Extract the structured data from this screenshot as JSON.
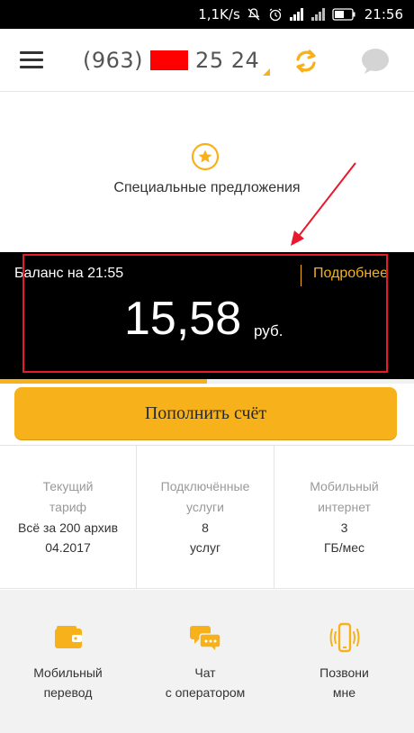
{
  "status_bar": {
    "speed": "1,1K/s",
    "time": "21:56",
    "icons": [
      "mute-icon",
      "alarm-icon",
      "signal-icon",
      "wifi-icon",
      "battery-icon"
    ]
  },
  "header": {
    "phone_prefix": "(963)",
    "phone_suffix": "25 24",
    "icons": [
      "menu-icon",
      "refresh-icon",
      "chat-icon"
    ]
  },
  "offers": {
    "label": "Специальные предложения",
    "icon": "star-icon"
  },
  "balance": {
    "label": "Баланс на 21:55",
    "more_label": "Подробнее",
    "amount": "15,58",
    "currency": "руб.",
    "progress": 0.5
  },
  "topup": {
    "label": "Пополнить счёт"
  },
  "info": [
    {
      "title_1": "Текущий",
      "title_2": "тариф",
      "value_1": "Всё за 200 архив",
      "value_2": "04.2017"
    },
    {
      "title_1": "Подключённые",
      "title_2": "услуги",
      "value_1": "8",
      "value_2": "услуг"
    },
    {
      "title_1": "Мобильный",
      "title_2": "интернет",
      "value_1": "3",
      "value_2": "ГБ/мес"
    }
  ],
  "actions": [
    {
      "label_1": "Мобильный",
      "label_2": "перевод",
      "icon": "wallet-icon"
    },
    {
      "label_1": "Чат",
      "label_2": "с оператором",
      "icon": "chat-bubbles-icon"
    },
    {
      "label_1": "Позвони",
      "label_2": "мне",
      "icon": "phone-ring-icon"
    }
  ],
  "colors": {
    "accent": "#f7b21b",
    "annotation": "#e8192c",
    "balance_bg": "#000000"
  }
}
